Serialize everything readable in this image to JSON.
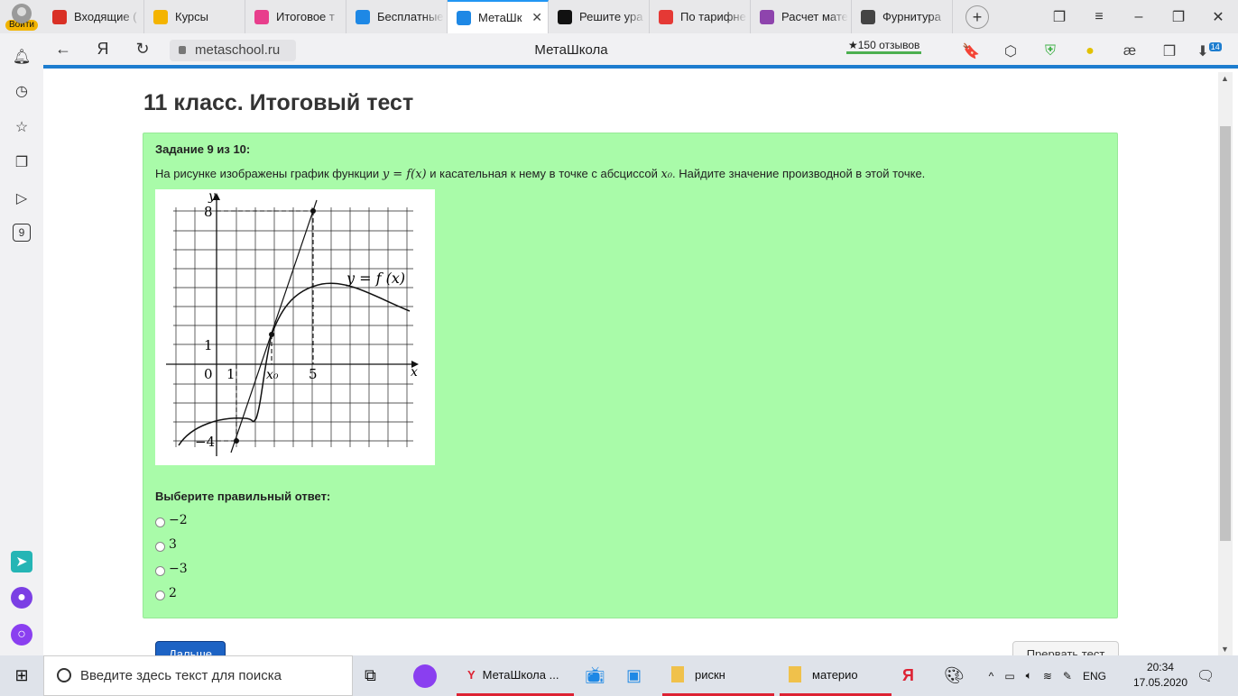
{
  "browser": {
    "login_label": "Войти",
    "tabs": [
      {
        "label": "Входящие (",
        "icon": "gmail-icon",
        "color": "#d93025"
      },
      {
        "label": "Курсы",
        "icon": "classroom-icon",
        "color": "#f4b400"
      },
      {
        "label": "Итоговое т",
        "icon": "metaschool-icon",
        "color": "#e83e8c"
      },
      {
        "label": "Бесплатные",
        "icon": "metaschool-icon",
        "color": "#1e88e5"
      },
      {
        "label": "МетаШк",
        "icon": "metaschool-icon",
        "color": "#1e88e5",
        "active": true
      },
      {
        "label": "Решите ура",
        "icon": "znanija-icon",
        "color": "#111111"
      },
      {
        "label": "По тарифне",
        "icon": "yandex-icon",
        "color": "#e53935"
      },
      {
        "label": "Расчет мате",
        "icon": "metaschool-icon",
        "color": "#8e44ad"
      },
      {
        "label": "Фурнитура",
        "icon": "star-icon",
        "color": "#444444"
      }
    ],
    "url": "metaschool.ru",
    "page_title": "МетаШкола",
    "reviews": "★150 отзывов",
    "downloads_badge": "14"
  },
  "sidebar": {
    "badge_9": "9"
  },
  "page": {
    "heading": "11 класс. Итоговый тест",
    "task_number": "Задание 9 из 10:",
    "question_before": "На рисунке изображены график функции ",
    "question_func": "y = f(x)",
    "question_middle": " и касательная к нему в точке с абсциссой ",
    "question_x0": "x₀",
    "question_after": ". Найдите значение производной в этой точке.",
    "choose_label": "Выберите правильный ответ:",
    "options": [
      "−2",
      "3",
      "−3",
      "2"
    ],
    "next_button": "Дальше",
    "stop_button": "Прервать тест"
  },
  "graph": {
    "axis_y": "y",
    "axis_x": "x",
    "label_8": "8",
    "label_1y": "1",
    "label_0": "0",
    "label_1x": "1",
    "label_x0": "x₀",
    "label_5": "5",
    "label_m4": "−4",
    "func_label": "y = f (x)"
  },
  "taskbar": {
    "search_placeholder": "Введите здесь текст для поиска",
    "app_browser": "МетаШкола ...",
    "folder1": "рискн",
    "folder2": "материо",
    "lang": "ENG",
    "time": "20:34",
    "date": "17.05.2020"
  }
}
